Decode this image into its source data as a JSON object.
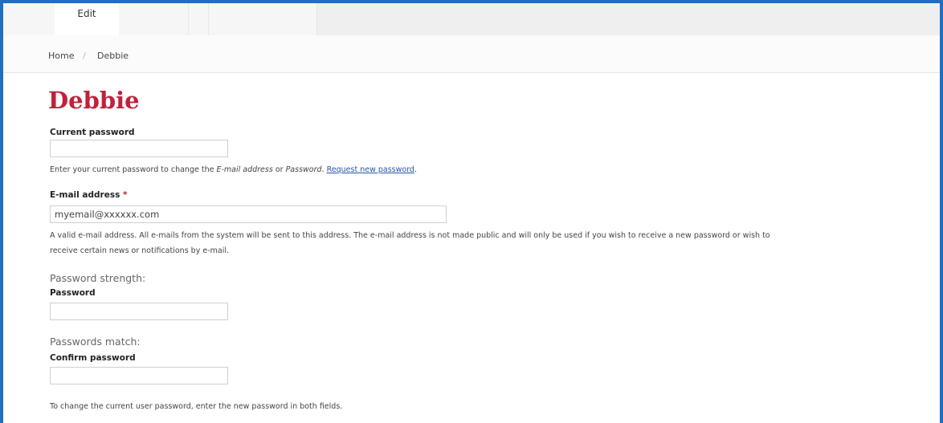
{
  "tabs": {
    "edit_label": "Edit"
  },
  "breadcrumb": {
    "home": "Home",
    "separator": "/",
    "current": "Debbie"
  },
  "page": {
    "title": "Debbie"
  },
  "form": {
    "current_password": {
      "label": "Current password",
      "value": "",
      "description_before": "Enter your current password to change the ",
      "description_email": "E-mail address",
      "description_or": " or ",
      "description_password": "Password",
      "description_dot": ". ",
      "request_link": "Request new password",
      "description_end": "."
    },
    "email": {
      "label": "E-mail address",
      "required_marker": "*",
      "value": "myemail@xxxxxx.com",
      "description_line1": "A valid e-mail address. All e-mails from the system will be sent to this address. The e-mail address is not made public and will only be used if you wish to receive a new password or wish to",
      "description_line2": "receive certain news or notifications by e-mail."
    },
    "password": {
      "strength_label": "Password strength:",
      "label": "Password",
      "value": ""
    },
    "confirm_password": {
      "match_label": "Passwords match:",
      "label": "Confirm password",
      "value": ""
    },
    "help_text": "To change the current user password, enter the new password in both fields."
  },
  "colors": {
    "frame_border": "#1f6fc4",
    "title": "#c0213b",
    "link": "#2a56a8"
  }
}
